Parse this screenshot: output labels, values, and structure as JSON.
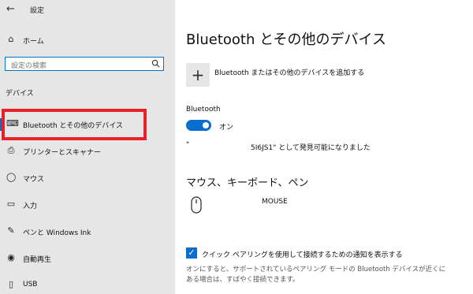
{
  "titlebar": {
    "back_icon": "back-arrow-icon",
    "title": "設定"
  },
  "sidebar": {
    "home": {
      "icon": "home-icon",
      "label": "ホーム"
    },
    "search": {
      "placeholder": "設定の検索",
      "icon": "search-icon"
    },
    "section_title": "デバイス",
    "items": [
      {
        "icon": "bluetooth-devices-icon",
        "label": "Bluetooth とその他のデバイス",
        "selected": true
      },
      {
        "icon": "printer-icon",
        "label": "プリンターとスキャナー"
      },
      {
        "icon": "mouse-icon",
        "label": "マウス"
      },
      {
        "icon": "keyboard-icon",
        "label": "入力"
      },
      {
        "icon": "pen-icon",
        "label": "ペンと Windows Ink"
      },
      {
        "icon": "autoplay-icon",
        "label": "自動再生"
      },
      {
        "icon": "usb-icon",
        "label": "USB"
      }
    ]
  },
  "main": {
    "title": "Bluetooth とその他のデバイス",
    "add_device": {
      "icon": "plus-icon",
      "label": "Bluetooth またはその他のデバイスを追加する"
    },
    "bluetooth": {
      "label": "Bluetooth",
      "toggle_state": "オン",
      "discoverable_prefix": "\"",
      "discoverable_text": "5I6JS1\" として発見可能になりました"
    },
    "mouse_section": {
      "heading": "マウス、キーボード、ペン",
      "device_name": "MOUSE"
    },
    "swift_pair": {
      "checkbox_label": "クイック ペアリングを使用して接続するための通知を表示する",
      "checked": true,
      "description": "オンにすると、サポートされているペアリング モードの Bluetooth デバイスが近くにある場合は、すばやく接続できます。"
    }
  },
  "colors": {
    "accent": "#0a6ed1",
    "highlight": "#e8202a",
    "sidebar_bg": "#e6e6e6"
  }
}
